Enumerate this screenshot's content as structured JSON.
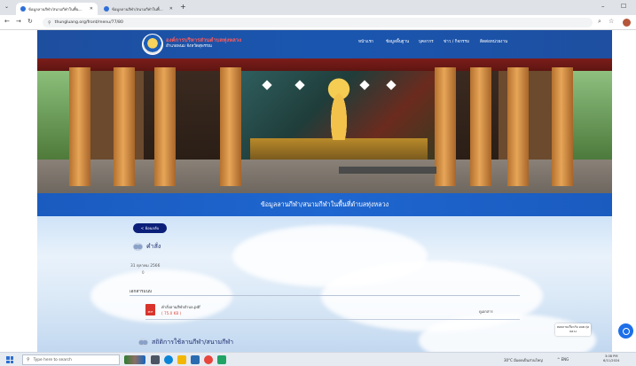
{
  "browser": {
    "tabs": [
      {
        "title": "ข้อมูลลานกีฬา/สนามกีฬาในพื้นที่ตำบลทุ่งหลวง",
        "active": true
      },
      {
        "title": "ข้อมูลลานกีฬา/สนามกีฬาในพื้นที่ตำบลทุ่งหลวง",
        "active": false
      }
    ],
    "new_tab": "+",
    "url": "thungluang.org/front/menu/77/80",
    "window_controls": {
      "minimize": "–",
      "maximize": "☐"
    }
  },
  "site": {
    "name": "องค์การบริหารส่วนตำบลทุ่งหลวง",
    "subtitle": "อำเภอพนม จังหวัดสุพรรณ",
    "menu": [
      "หน้าแรก",
      "ข้อมูลพื้นฐาน",
      "บุคลากร",
      "ข่าว / กิจกรรม",
      "ติดต่อหน่วยงาน"
    ]
  },
  "page": {
    "title": "ข้อมูลลานกีฬา/สนามกีฬาในพื้นที่ตำบลทุ่งหลวง",
    "back_label": "< ย้อนกลับ",
    "section1": {
      "title": "คำสั่ง",
      "date": "31 ตุลาคม 2566",
      "mark": "0",
      "documents_label": "เอกสารแนบ",
      "file": {
        "name": "คำสั่งลานกีฬาตำบล.pdf",
        "size": "( 75.0 KB )",
        "download": "ดูเอกสาร"
      }
    },
    "section2": {
      "title": "สถิติการใช้ลานกีฬา/สนามกีฬา"
    }
  },
  "chat": {
    "text": "สอบถามเกี่ยวกับ อบต.ทุ่ง หลวง"
  },
  "taskbar": {
    "search_placeholder": "Type here to search",
    "weather": "30°C มีแดดเป็นส่วนใหญ่",
    "tray": "^  ENG",
    "time": "3:08 PM",
    "date": "6/11/2024"
  },
  "colors": {
    "header_blue": "#1a56b0",
    "title_band": "#1e66d0",
    "back_button": "#0b1f7a",
    "file_size_red": "#e04a3a"
  }
}
